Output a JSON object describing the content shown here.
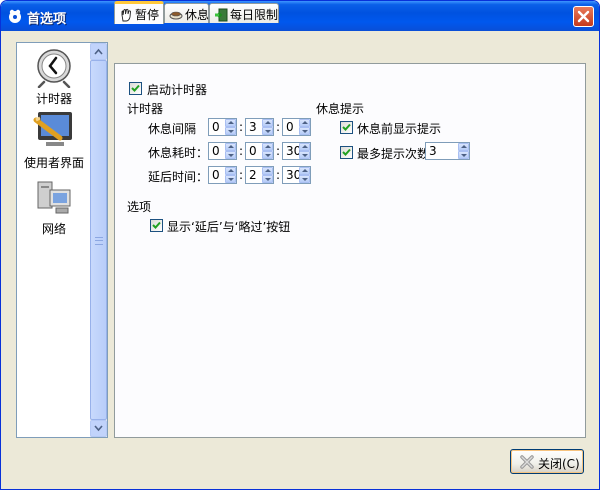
{
  "window": {
    "title": "首选项"
  },
  "sidebar": {
    "items": [
      {
        "label": "计时器",
        "icon": "clock-icon",
        "selected": true
      },
      {
        "label": "使用者界面",
        "icon": "monitor-pencil-icon",
        "selected": false
      },
      {
        "label": "网络",
        "icon": "network-computers-icon",
        "selected": false
      }
    ]
  },
  "tabs": [
    {
      "label": "暂停",
      "icon": "hand-icon",
      "active": true
    },
    {
      "label": "休息",
      "icon": "cup-icon",
      "active": false
    },
    {
      "label": "每日限制",
      "icon": "exit-icon",
      "active": false
    }
  ],
  "panel": {
    "enable_timer": {
      "label": "启动计时器",
      "checked": true
    },
    "timer_section": {
      "title": "计时器",
      "rows": [
        {
          "label": "休息间隔",
          "h": "0",
          "m": "3",
          "s": "0"
        },
        {
          "label": "休息耗时：",
          "h": "0",
          "m": "0",
          "s": "30"
        },
        {
          "label": "延后时间：",
          "h": "0",
          "m": "2",
          "s": "30"
        }
      ],
      "separator": ":"
    },
    "hint_section": {
      "title": "休息提示",
      "show_before": {
        "label": "休息前显示提示",
        "checked": true
      },
      "max_hints": {
        "label": "最多提示次数",
        "checked": true,
        "value": "3"
      }
    },
    "options_section": {
      "title": "选项",
      "show_buttons": {
        "label": "显示‘延后’与‘略过’按钮",
        "checked": true
      }
    }
  },
  "footer": {
    "close_label": "关闭(C)"
  },
  "colors": {
    "titlebar": "#0058ee",
    "dialog_bg": "#ece9d8",
    "active_tab_accent": "#ffc83c"
  }
}
